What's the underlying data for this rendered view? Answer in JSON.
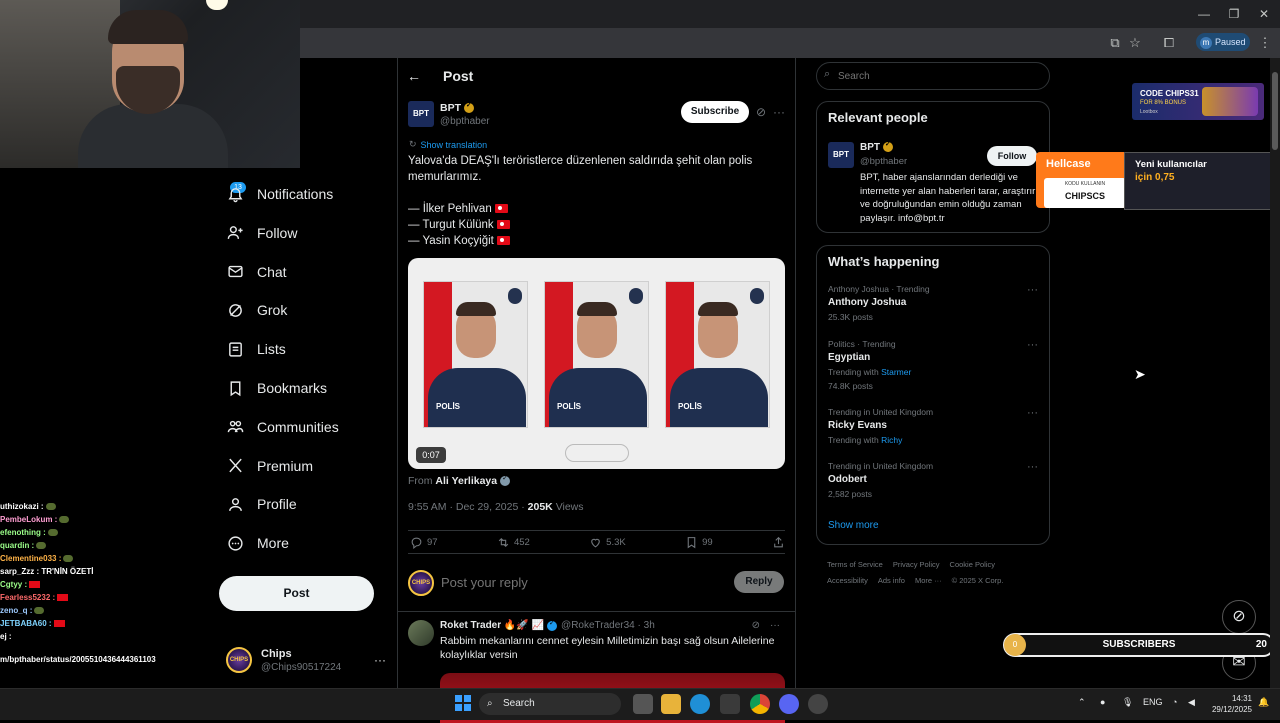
{
  "browser": {
    "paused_initial": "m",
    "paused_label": "Paused"
  },
  "chat": [
    {
      "user": "uthizokazi :",
      "color": "#ffffff",
      "emote": "green"
    },
    {
      "user": "PembeLokum :",
      "color": "#ff9ed2",
      "emote": "green"
    },
    {
      "user": "efenothing :",
      "color": "#9cff8a",
      "emote": "green"
    },
    {
      "user": "quardin :",
      "color": "#9cff8a",
      "emote": "green"
    },
    {
      "user": "Clementine033 :",
      "color": "#ffb347",
      "emote": "green"
    },
    {
      "user": "sarp_Zzz : TR'NİN ÖZETİ",
      "color": "#ffffff",
      "emote": ""
    },
    {
      "user": "Cgtyy :",
      "color": "#9cff8a",
      "emote": "flag"
    },
    {
      "user": "Fearless5232 :",
      "color": "#ff6b6b",
      "emote": "flag"
    },
    {
      "user": "zeno_q :",
      "color": "#9ecbff",
      "emote": "green"
    },
    {
      "user": "JETBABA60 :",
      "color": "#7fd4ff",
      "emote": "flag"
    },
    {
      "user": "ej :",
      "color": "#ffffff",
      "emote": ""
    }
  ],
  "chat_url": "m/bpthaber/status/2005510436444361103",
  "nav": {
    "notifications_badge": "13",
    "items": [
      {
        "label": "Notifications",
        "icon": "bell-icon"
      },
      {
        "label": "Follow",
        "icon": "person-plus-icon"
      },
      {
        "label": "Chat",
        "icon": "mail-icon"
      },
      {
        "label": "Grok",
        "icon": "grok-icon"
      },
      {
        "label": "Lists",
        "icon": "list-icon"
      },
      {
        "label": "Bookmarks",
        "icon": "bookmark-icon"
      },
      {
        "label": "Communities",
        "icon": "people-icon"
      },
      {
        "label": "Premium",
        "icon": "x-logo-icon"
      },
      {
        "label": "Profile",
        "icon": "person-icon"
      },
      {
        "label": "More",
        "icon": "more-circle-icon"
      }
    ],
    "post_button": "Post",
    "account": {
      "name": "Chips",
      "handle": "@Chips90517224",
      "avatar_text": "CHIPS"
    }
  },
  "post": {
    "header_title": "Post",
    "author": {
      "name": "BPT",
      "handle": "@bpthaber",
      "logo_text": "BPT"
    },
    "subscribe": "Subscribe",
    "show_translation": "Show translation",
    "text_line1": "Yalova'da DEAŞ'lı teröristlerce düzenlenen saldırıda şehit olan polis memurlarımız.",
    "names": [
      "— İlker Pehlivan",
      "— Turgut Külünk",
      "— Yasin Koçyiğit"
    ],
    "video_time": "0:07",
    "polis_label": "POLİS",
    "from_prefix": "From",
    "from_name": "Ali Yerlikaya",
    "time": "9:55 AM · Dec 29, 2025 ·",
    "views_count": "205K",
    "views_label": "Views",
    "stats": {
      "replies": "97",
      "reposts": "452",
      "likes": "5.3K",
      "bookmarks": "99"
    },
    "reply_placeholder": "Post your reply",
    "reply_button": "Reply"
  },
  "reply": {
    "name": "Roket Trader 🔥🚀 📈",
    "handle": "@RokeTrader34 · 3h",
    "text": "Rabbim mekanlarını cennet eylesin Milletimizin başı sağ olsun Ailelerine kolaylıklar versin"
  },
  "sidebar": {
    "search_placeholder": "Search",
    "relevant_title": "Relevant people",
    "person": {
      "name": "BPT",
      "handle": "@bpthaber",
      "follow": "Follow",
      "bio": "BPT, haber ajanslarından derlediği ve internette yer alan haberleri tarar, araştırır ve doğruluğundan emin olduğu zaman paylaşır. info@bpt.tr"
    },
    "happening_title": "What’s happening",
    "trends": [
      {
        "context": "Anthony Joshua · Trending",
        "name": "Anthony Joshua",
        "with_label": "",
        "with": "",
        "posts": "25.3K posts"
      },
      {
        "context": "Politics · Trending",
        "name": "Egyptian",
        "with_label": "Trending with",
        "with": "Starmer",
        "posts": "74.8K posts"
      },
      {
        "context": "Trending in United Kingdom",
        "name": "Ricky Evans",
        "with_label": "Trending with",
        "with": "Richy",
        "posts": ""
      },
      {
        "context": "Trending in United Kingdom",
        "name": "Odobert",
        "with_label": "",
        "with": "",
        "posts": "2,582 posts"
      }
    ],
    "show_more": "Show more",
    "footer": [
      "Terms of Service",
      "Privacy Policy",
      "Cookie Policy",
      "Accessibility",
      "Ads info",
      "More ···",
      "© 2025 X Corp."
    ]
  },
  "overlays": {
    "code_ad": {
      "line1": "CODE CHIPS31",
      "line2": "FOR 8% BONUS",
      "brand": "Lootbox"
    },
    "hellcase": {
      "brand": "Hellcase",
      "sub": "KODU KULLANIN",
      "code": "CHIPSCS",
      "line1": "Yeni kullanıcılar",
      "line2": "için 0,75"
    },
    "subscribers": {
      "current": "0",
      "label": "SUBSCRIBERS",
      "goal": "20",
      "progress": 0
    }
  },
  "taskbar": {
    "search": "Search",
    "lang": "ENG",
    "time": "14:31",
    "date": "29/12/2025"
  }
}
